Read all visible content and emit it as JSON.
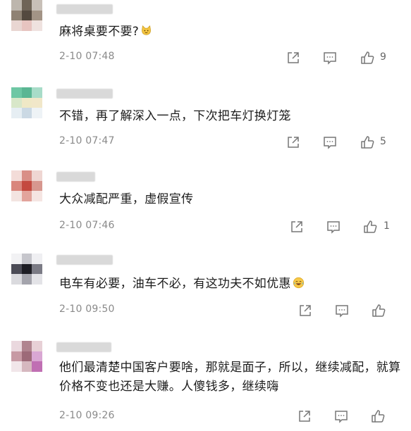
{
  "comments": [
    {
      "text": "麻将桌要不要?",
      "emoji": "cat-face-emoji",
      "time": "2-10 07:48",
      "likes": "9",
      "avatar": [
        "#bdb6ad",
        "#6f6457",
        "#c8c0b8",
        "#8f8274",
        "#54493f",
        "#a39486",
        "#e9d6d2",
        "#e7c4c0",
        "#efe2df"
      ]
    },
    {
      "text": "不错，再了解深入一点，下次把车灯换灯笼",
      "time": "2-10 07:47",
      "likes": "5",
      "avatar": [
        "#6ec7a4",
        "#5bb693",
        "#a8dcc8",
        "#d8e7c9",
        "#efe8c6",
        "#f1e7c9",
        "#e6eef3",
        "#cbd9e4",
        "#eef3f6"
      ]
    },
    {
      "text": "大众减配严重，虚假宣传",
      "time": "2-10 07:46",
      "likes": "1",
      "avatar": [
        "#f3dcd8",
        "#d98f86",
        "#efd6d2",
        "#d9867c",
        "#c4493f",
        "#d7978f",
        "#f3e4e1",
        "#e2a49c",
        "#f5e5e2"
      ]
    },
    {
      "text": "电车有必要，油车不必，有这功夫不如优惠",
      "emoji": "laughing-tears-emoji",
      "time": "2-10 09:50",
      "likes": "",
      "avatar": [
        "#f2f2f4",
        "#c6c6cc",
        "#efeff2",
        "#4c4c56",
        "#1d1d24",
        "#7b7b85",
        "#dadade",
        "#a4a4ac",
        "#e3e3e7"
      ]
    },
    {
      "text": "他们最清楚中国客户要啥，那就是面子，所以，继续减配，就算价格不变也还是大赚。人傻钱多，继续嗨",
      "time": "2-10 09:26",
      "likes": "",
      "avatar": [
        "#ead8de",
        "#b0848f",
        "#e7d0d6",
        "#c79aa4",
        "#9d6a78",
        "#d9a7d3",
        "#f1e6e9",
        "#d6b8bf",
        "#c06fb3"
      ]
    }
  ]
}
